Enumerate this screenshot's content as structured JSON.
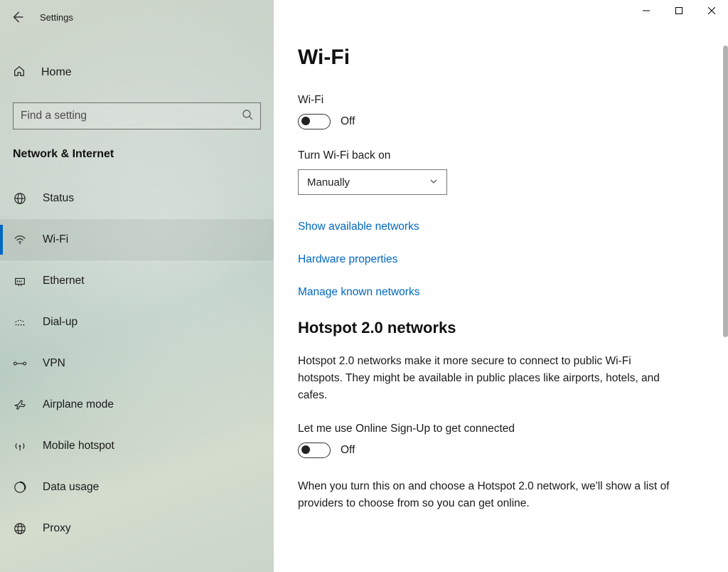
{
  "titlebar": {
    "app_name": "Settings"
  },
  "sidebar": {
    "home_label": "Home",
    "search_placeholder": "Find a setting",
    "category": "Network & Internet",
    "items": [
      {
        "label": "Status"
      },
      {
        "label": "Wi-Fi"
      },
      {
        "label": "Ethernet"
      },
      {
        "label": "Dial-up"
      },
      {
        "label": "VPN"
      },
      {
        "label": "Airplane mode"
      },
      {
        "label": "Mobile hotspot"
      },
      {
        "label": "Data usage"
      },
      {
        "label": "Proxy"
      }
    ]
  },
  "main": {
    "title": "Wi-Fi",
    "wifi_label": "Wi-Fi",
    "wifi_state": "Off",
    "turn_back_label": "Turn Wi-Fi back on",
    "turn_back_value": "Manually",
    "links": {
      "show_networks": "Show available networks",
      "hw_props": "Hardware properties",
      "known_networks": "Manage known networks"
    },
    "hotspot": {
      "title": "Hotspot 2.0 networks",
      "desc": "Hotspot 2.0 networks make it more secure to connect to public Wi-Fi hotspots. They might be available in public places like airports, hotels, and cafes.",
      "signup_label": "Let me use Online Sign-Up to get connected",
      "signup_state": "Off",
      "signup_desc": "When you turn this on and choose a Hotspot 2.0 network, we'll show a list of providers to choose from so you can get online."
    }
  }
}
